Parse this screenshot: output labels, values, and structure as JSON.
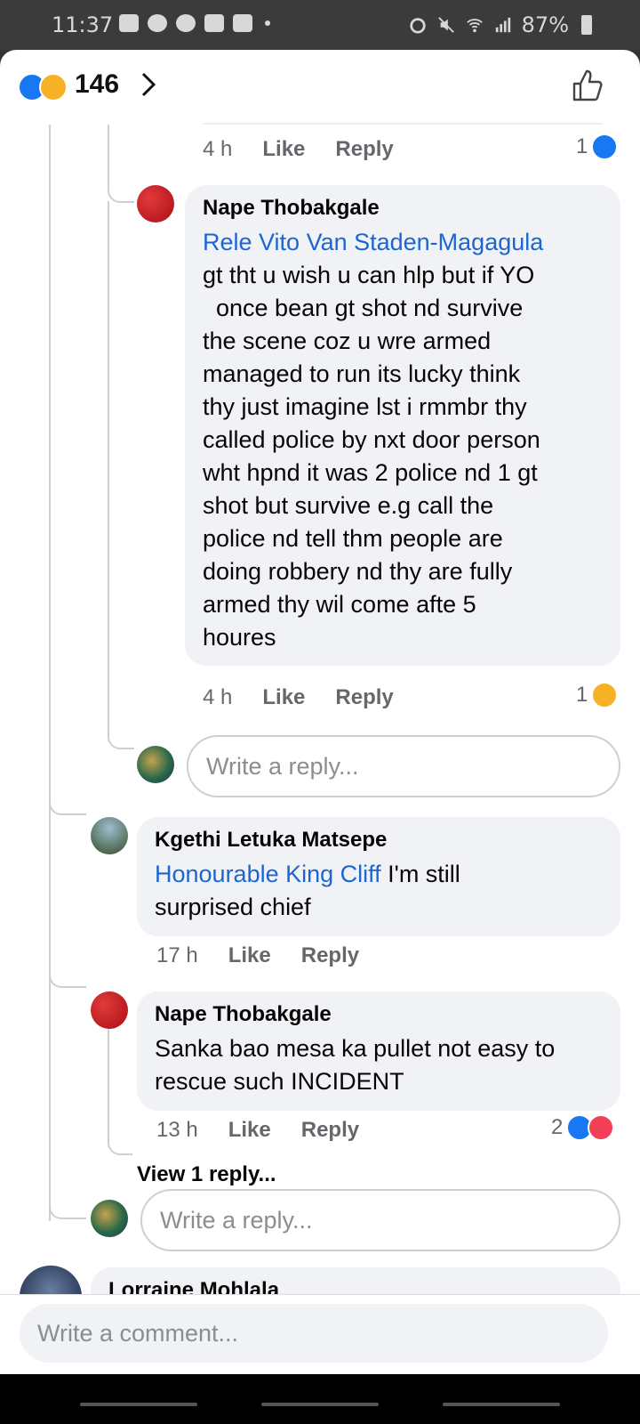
{
  "status_bar": {
    "time": "11:37",
    "battery": "87%"
  },
  "header": {
    "reaction_count": "146"
  },
  "comments": [
    {
      "id": "prev",
      "time": "4 h",
      "like_label": "Like",
      "reply_label": "Reply",
      "reaction_count": "1",
      "reactions": [
        "like"
      ]
    },
    {
      "id": "nape1",
      "author": "Nape Thobakgale",
      "mention": "Rele Vito Van Staden-Magagula",
      "lines": [
        "gt tht u wish u can hlp but if YO",
        "  once bean gt shot nd survive",
        "the scene coz u wre armed",
        "managed to run its lucky think",
        "thy just imagine lst i rmmbr thy",
        "called police by nxt door person",
        "wht hpnd it was 2 police nd 1 gt",
        "shot but survive e.g call the",
        "police nd tell thm people are",
        "doing robbery nd thy are fully",
        "armed thy wil come afte 5",
        "houres"
      ],
      "time": "4 h",
      "like_label": "Like",
      "reply_label": "Reply",
      "reaction_count": "1",
      "reactions": [
        "sad"
      ]
    },
    {
      "id": "kgethi",
      "author": "Kgethi Letuka Matsepe",
      "mention": "Honourable King Cliff",
      "text_after_mention": " I'm still",
      "text_line2": "surprised chief",
      "time": "17 h",
      "like_label": "Like",
      "reply_label": "Reply"
    },
    {
      "id": "nape2",
      "author": "Nape Thobakgale",
      "line1": "Sanka bao mesa ka pullet not easy to",
      "line2": "rescue such INCIDENT",
      "time": "13 h",
      "like_label": "Like",
      "reply_label": "Reply",
      "reaction_count": "2",
      "reactions": [
        "like",
        "love"
      ],
      "view_replies": "View 1 reply..."
    },
    {
      "id": "lorraine",
      "author": "Lorraine Mohlala"
    }
  ],
  "reply_placeholder": "Write a reply...",
  "comment_placeholder": "Write a comment...",
  "colors": {
    "accent": "#1877f2",
    "mention": "#1b66d2",
    "bubble": "#f0f2f5"
  }
}
